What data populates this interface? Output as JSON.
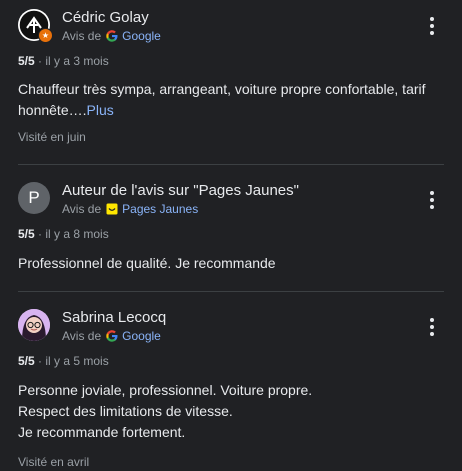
{
  "reviews": [
    {
      "author": "Cédric Golay",
      "source_prefix": "Avis de",
      "source_name": "Google",
      "rating": "5/5",
      "time": "il y a 3 mois",
      "text": "Chauffeur très sympa, arrangeant, voiture propre confortable, tarif honnête….",
      "more_label": "Plus",
      "visited": "Visité en juin"
    },
    {
      "author": "Auteur de l'avis sur \"Pages Jaunes\"",
      "avatar_letter": "P",
      "source_prefix": "Avis de",
      "source_name": "Pages Jaunes",
      "rating": "5/5",
      "time": "il y a 8 mois",
      "text": "Professionnel de qualité. Je recommande"
    },
    {
      "author": "Sabrina Lecocq",
      "source_prefix": "Avis de",
      "source_name": "Google",
      "rating": "5/5",
      "time": "il y a 5 mois",
      "text_lines": [
        "Personne joviale, professionnel. Voiture propre.",
        "Respect des limitations de vitesse.",
        "Je recommande fortement."
      ],
      "visited": "Visité en avril"
    }
  ],
  "colors": {
    "background": "#202124",
    "link": "#8ab4f8",
    "muted": "#9aa0a6",
    "divider": "#3c4043"
  }
}
